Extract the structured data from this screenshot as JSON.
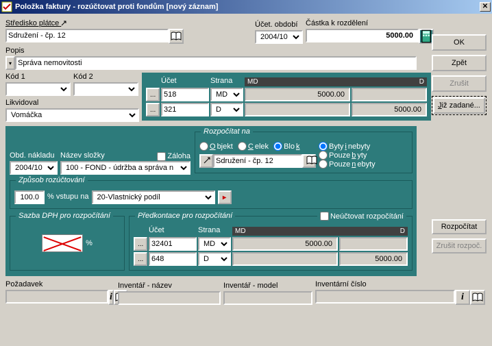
{
  "window": {
    "title": "Položka faktury - rozúčtovat proti fondům  [nový záznam]"
  },
  "header": {
    "stredisko_label": "Středisko plátce",
    "stredisko_value": "Sdružení - čp. 12",
    "ucet_obdobi_label": "Účet. období",
    "ucet_obdobi_value": "2004/10",
    "castka_label": "Částka k rozdělení",
    "castka_value": "5000.00"
  },
  "buttons": {
    "ok": "OK",
    "zpet": "Zpět",
    "zrusit": "Zrušit",
    "jiz_zadane": "Již zadané...",
    "rozpocitat": "Rozpočítat",
    "zrusit_rozpoc": "Zrušit rozpoč."
  },
  "popis": {
    "label": "Popis",
    "value": "Správa nemovitosti"
  },
  "kod1_label": "Kód 1",
  "kod2_label": "Kód 2",
  "likvidoval_label": "Likvidoval",
  "likvidoval_value": "Vomáčka",
  "acct": {
    "ucet_hdr": "Účet",
    "strana_hdr": "Strana",
    "md_hdr": "MD",
    "d_hdr": "D",
    "row1_ucet": "518",
    "row1_strana": "MD",
    "row1_md": "5000.00",
    "row1_d": "",
    "row2_ucet": "321",
    "row2_strana": "D",
    "row2_md": "",
    "row2_d": "5000.00"
  },
  "obd": {
    "obd_nakladu_label": "Obd. nákladu",
    "obd_value": "2004/10",
    "nazev_slozky_label": "Název složky",
    "nazev_value": "100 - FOND - údržba a správa n",
    "zaloha_label": "Záloha"
  },
  "rozpocitat_na": {
    "legend": "Rozpočítat na",
    "objekt": "Objekt",
    "celek": "Celek",
    "blok": "Blok",
    "byty_nebyty": "Byty i nebyty",
    "pouze_byty": "Pouze byty",
    "pouze_nebyty": "Pouze nebyty",
    "target_value": "Sdružení - čp. 12"
  },
  "zpusob": {
    "legend": "Způsob rozúčtování",
    "pct": "100.0",
    "pct_label": "% vstupu na",
    "metoda": "20-Vlastnický podíl"
  },
  "sazba_legend": "Sazba DPH pro rozpočítání",
  "sazba_pct": "%",
  "predkontace": {
    "legend": "Předkontace pro rozpočítání",
    "neuctovat": "Neúčtovat rozpočítání",
    "ucet_hdr": "Účet",
    "strana_hdr": "Strana",
    "md_hdr": "MD",
    "d_hdr": "D",
    "row1_ucet": "32401",
    "row1_strana": "MD",
    "row1_md": "5000.00",
    "row1_d": "",
    "row2_ucet": "648",
    "row2_strana": "D",
    "row2_md": "",
    "row2_d": "5000.00"
  },
  "footer": {
    "pozadavek": "Požadavek",
    "inv_nazev": "Inventář - název",
    "inv_model": "Inventář - model",
    "inv_cislo": "Inventární číslo"
  },
  "icons": {
    "ellipsis": "...",
    "arrow": "▸"
  }
}
